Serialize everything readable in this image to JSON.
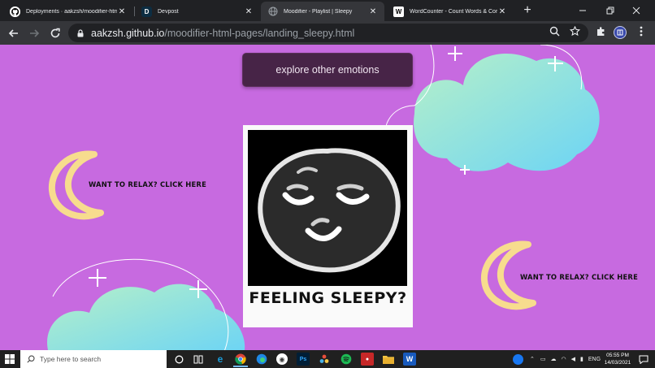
{
  "browser": {
    "tabs": [
      {
        "title": "Deployments · aakzsh/moodifier-html-pages",
        "favicon": "github-icon",
        "active": false
      },
      {
        "title": "Devpost",
        "favicon": "devpost-icon",
        "active": false
      },
      {
        "title": "Moodifier - Playlist | Sleepy",
        "favicon": "globe-icon",
        "active": true
      },
      {
        "title": "WordCounter - Count Words & Correct Writing",
        "favicon": "wordcounter-icon",
        "active": false
      }
    ],
    "close_glyph": "✕",
    "new_tab_glyph": "+",
    "url_domain": "aakzsh.github.io",
    "url_path": "/moodifier-html-pages/landing_sleepy.html"
  },
  "page": {
    "explore_label": "explore other emotions",
    "caption": "FEELING SLEEPY?",
    "relax_left": "WANT TO RELAX? CLICK HERE",
    "relax_right": "WANT TO RELAX? CLICK HERE",
    "colors": {
      "background": "#c76ae0",
      "button": "#472447",
      "moon": "#f7dc8e",
      "cloud_start": "#b7f0c8",
      "cloud_end": "#6cd4f5"
    }
  },
  "taskbar": {
    "search_placeholder": "Type here to search",
    "language": "ENG",
    "time": "05:55 PM",
    "date": "14/03/2021"
  }
}
